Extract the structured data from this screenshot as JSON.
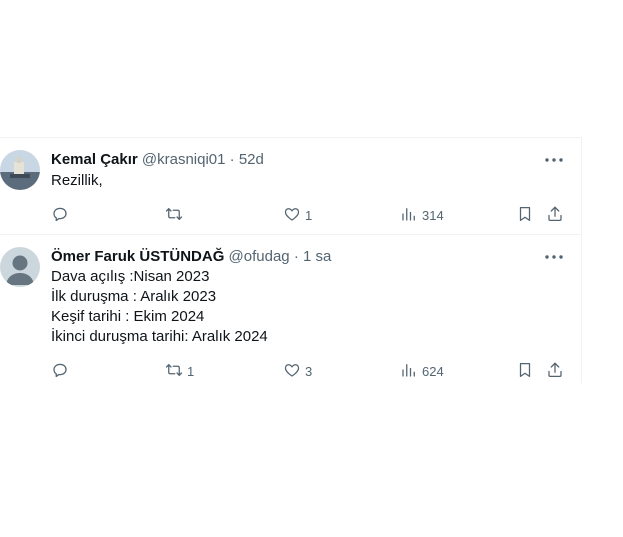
{
  "colors": {
    "text": "#0f1419",
    "secondary": "#536471",
    "border": "#eff3f4"
  },
  "tweets": [
    {
      "name": "Kemal Çakır",
      "handle": "@krasniqi01",
      "separator": "·",
      "time": "52d",
      "lines": [
        "Rezillik,"
      ],
      "reply_count": "",
      "retweet_count": "",
      "like_count": "1",
      "view_count": "314"
    },
    {
      "name": "Ömer Faruk ÜSTÜNDAĞ",
      "handle": "@ofudag",
      "separator": "·",
      "time": "1 sa",
      "lines": [
        "Dava açılış :Nisan 2023",
        "İlk duruşma : Aralık 2023",
        "Keşif tarihi : Ekim 2024",
        "İkinci duruşma tarihi: Aralık 2024"
      ],
      "reply_count": "",
      "retweet_count": "1",
      "like_count": "3",
      "view_count": "624"
    }
  ],
  "icons": [
    "reply-icon",
    "retweet-icon",
    "like-icon",
    "views-icon",
    "bookmark-icon",
    "share-icon",
    "more-icon"
  ]
}
